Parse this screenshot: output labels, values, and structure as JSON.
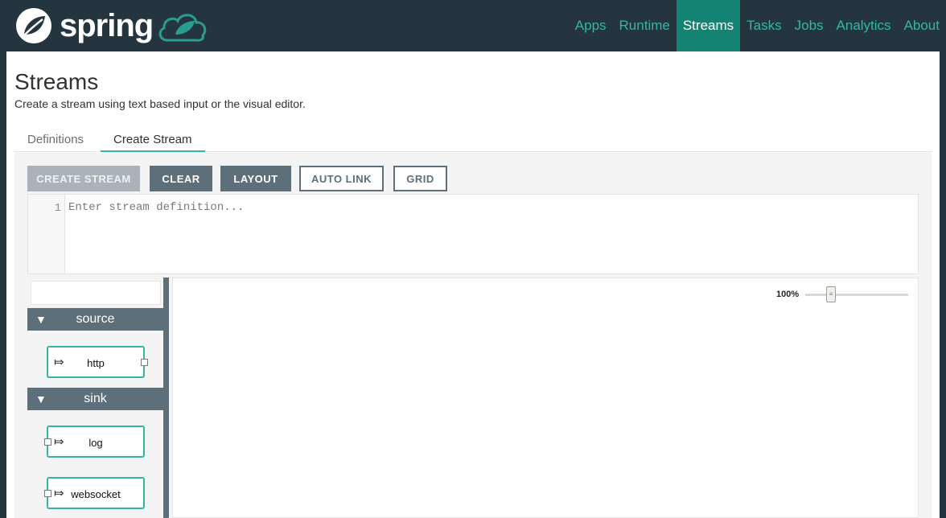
{
  "navbar": {
    "brand": "spring",
    "items": [
      {
        "label": "Apps"
      },
      {
        "label": "Runtime"
      },
      {
        "label": "Streams",
        "active": true
      },
      {
        "label": "Tasks"
      },
      {
        "label": "Jobs"
      },
      {
        "label": "Analytics"
      },
      {
        "label": "About"
      }
    ]
  },
  "page": {
    "title": "Streams",
    "subtitle": "Create a stream using text based input or the visual editor."
  },
  "tabs": [
    {
      "label": "Definitions",
      "active": false
    },
    {
      "label": "Create Stream",
      "active": true
    }
  ],
  "toolbar": {
    "create_stream": "CREATE STREAM",
    "clear": "CLEAR",
    "layout": "LAYOUT",
    "auto_link": "AUTO LINK",
    "grid": "GRID"
  },
  "editor": {
    "line_number": "1",
    "placeholder": "Enter stream definition..."
  },
  "palette": {
    "groups": [
      {
        "label": "source",
        "toggle": "▼",
        "nodes": [
          {
            "label": "http"
          }
        ]
      },
      {
        "label": "sink",
        "toggle": "▼",
        "nodes": [
          {
            "label": "log"
          },
          {
            "label": "websocket"
          }
        ]
      }
    ],
    "node_icon": "⤇"
  },
  "canvas": {
    "zoom_label": "100%",
    "zoom_percent": 100
  },
  "colors": {
    "navbar_bg": "#243540",
    "accent": "#34b5a4",
    "active_nav": "#138373",
    "toolbar_dark": "#5d6f79"
  },
  "icons": {
    "logo": "spring-leaf-icon",
    "cloud": "cloud-icon",
    "toggle": "triangle-down-icon",
    "node": "arrow-icon"
  }
}
